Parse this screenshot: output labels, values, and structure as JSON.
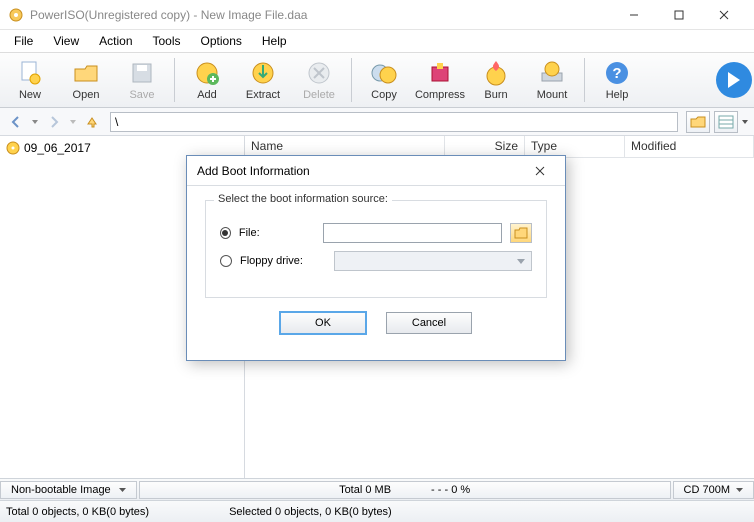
{
  "window": {
    "title": "PowerISO(Unregistered copy) - New Image File.daa"
  },
  "menu": [
    "File",
    "View",
    "Action",
    "Tools",
    "Options",
    "Help"
  ],
  "toolbar": {
    "new": "New",
    "open": "Open",
    "save": "Save",
    "add": "Add",
    "extract": "Extract",
    "delete": "Delete",
    "copy": "Copy",
    "compress": "Compress",
    "burn": "Burn",
    "mount": "Mount",
    "help": "Help"
  },
  "nav": {
    "path": "\\"
  },
  "tree": {
    "root": "09_06_2017"
  },
  "columns": {
    "name": "Name",
    "size": "Size",
    "type": "Type",
    "modified": "Modified"
  },
  "status": {
    "bootable": "Non-bootable Image",
    "total": "Total  0 MB",
    "percent": "- - -  0 %",
    "disc": "CD 700M",
    "line1": "Total 0 objects, 0 KB(0 bytes)",
    "line2": "Selected 0 objects, 0 KB(0 bytes)"
  },
  "dialog": {
    "title": "Add Boot Information",
    "legend": "Select the boot information source:",
    "file_label": "File:",
    "floppy_label": "Floppy drive:",
    "file_value": "",
    "ok": "OK",
    "cancel": "Cancel"
  }
}
